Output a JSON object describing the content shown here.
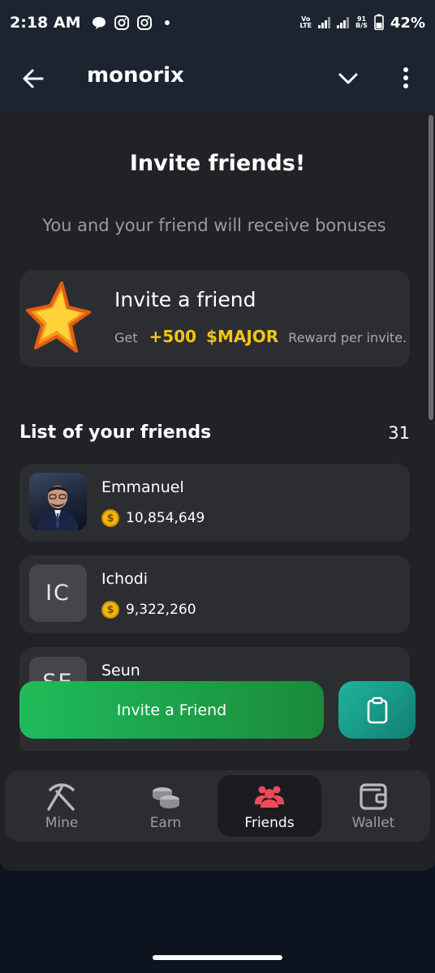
{
  "status_bar": {
    "time": "2:18 AM",
    "net_speed_top": "91",
    "net_speed_bottom": "B/S",
    "volte_top": "Vo",
    "volte_bottom": "LTE",
    "battery": "42%"
  },
  "header": {
    "title": "monorix"
  },
  "page": {
    "title": "Invite friends!",
    "subtitle": "You and your friend will receive bonuses"
  },
  "invite_card": {
    "heading": "Invite a friend",
    "get_label": "Get",
    "amount": "+500",
    "token": "$MAJOR",
    "tail": "Reward per invite."
  },
  "friends_list": {
    "title": "List of your friends",
    "count": "31",
    "items": [
      {
        "name": "Emmanuel",
        "initials": "",
        "balance": "10,854,649"
      },
      {
        "name": "Ichodi",
        "initials": "IC",
        "balance": "9,322,260"
      },
      {
        "name": "Seun",
        "initials": "SE",
        "balance": ""
      }
    ]
  },
  "actions": {
    "invite_button": "Invite a Friend"
  },
  "tabs": [
    {
      "label": "Mine",
      "icon": "pickaxe-icon",
      "active": false
    },
    {
      "label": "Earn",
      "icon": "coins-icon",
      "active": false
    },
    {
      "label": "Friends",
      "icon": "friends-icon",
      "active": true
    },
    {
      "label": "Wallet",
      "icon": "wallet-icon",
      "active": false
    }
  ],
  "colors": {
    "accent_gold": "#f4c417",
    "accent_green": "#1fbc5a",
    "accent_teal": "#1fb59c",
    "friends_active": "#ef4a5a"
  }
}
